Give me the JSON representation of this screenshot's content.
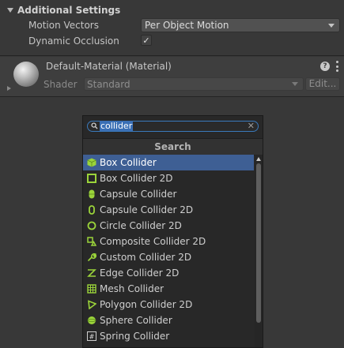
{
  "additional_settings": {
    "title": "Additional Settings",
    "motion_vectors": {
      "label": "Motion Vectors",
      "value": "Per Object Motion"
    },
    "dynamic_occlusion": {
      "label": "Dynamic Occlusion",
      "checked": true,
      "mark": "✓"
    }
  },
  "material": {
    "name": "Default-Material (Material)",
    "help_glyph": "?",
    "shader_label": "Shader",
    "shader_value": "Standard",
    "edit_label": "Edit..."
  },
  "add_component_popup": {
    "search": {
      "value": "collider",
      "clear_glyph": "✕"
    },
    "title": "Search",
    "items": [
      {
        "label": "Box Collider",
        "icon": "box-collider-icon",
        "selected": true
      },
      {
        "label": "Box Collider 2D",
        "icon": "box-collider-2d-icon",
        "selected": false
      },
      {
        "label": "Capsule Collider",
        "icon": "capsule-collider-icon",
        "selected": false
      },
      {
        "label": "Capsule Collider 2D",
        "icon": "capsule-collider-2d-icon",
        "selected": false
      },
      {
        "label": "Circle Collider 2D",
        "icon": "circle-collider-2d-icon",
        "selected": false
      },
      {
        "label": "Composite Collider 2D",
        "icon": "composite-collider-2d-icon",
        "selected": false
      },
      {
        "label": "Custom Collider 2D",
        "icon": "custom-collider-2d-icon",
        "selected": false
      },
      {
        "label": "Edge Collider 2D",
        "icon": "edge-collider-2d-icon",
        "selected": false
      },
      {
        "label": "Mesh Collider",
        "icon": "mesh-collider-icon",
        "selected": false
      },
      {
        "label": "Polygon Collider 2D",
        "icon": "polygon-collider-2d-icon",
        "selected": false
      },
      {
        "label": "Sphere Collider",
        "icon": "sphere-collider-icon",
        "selected": false
      },
      {
        "label": "Spring Collider",
        "icon": "spring-collider-icon",
        "selected": false
      }
    ]
  },
  "colors": {
    "background": "#383838",
    "popup_background": "#282828",
    "selection": "#3e5f94",
    "collider_icon_green": "#9bd43a",
    "search_highlight": "#3a6fb5"
  }
}
